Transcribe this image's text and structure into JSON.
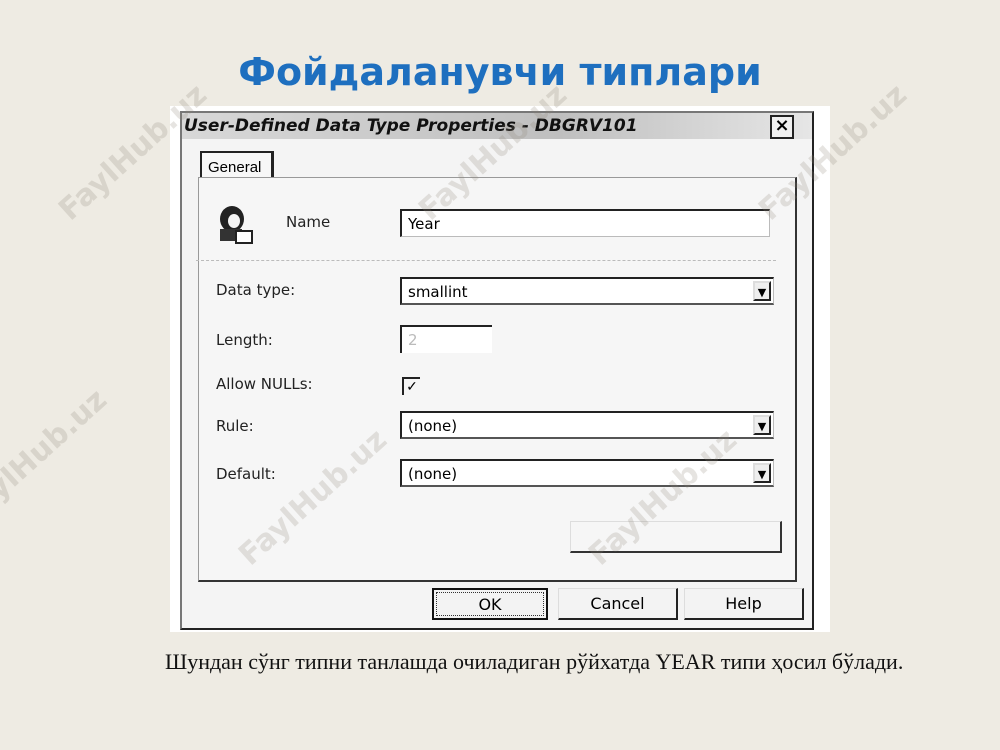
{
  "slide": {
    "title": "Фойдаланувчи типлари",
    "caption": "Шундан сўнг типни танлашда очиладиган рўйхатда YEAR типи ҳосил бўлади."
  },
  "dialog": {
    "title": "User-Defined Data Type Properties - DBGRV101",
    "close_label": "×",
    "tab_general": "General",
    "fields": {
      "name_label": "Name",
      "name_value": "Year",
      "data_type_label": "Data type:",
      "data_type_value": "smallint",
      "length_label": "Length:",
      "length_value": "2",
      "allow_nulls_label": "Allow NULLs:",
      "allow_nulls_checked": "✓",
      "rule_label": "Rule:",
      "rule_value": "(none)",
      "default_label": "Default:",
      "default_value": "(none)"
    },
    "buttons": {
      "ok": "OK",
      "cancel": "Cancel",
      "help": "Help"
    },
    "icons": {
      "user_type_icon": "user-type-icon",
      "dropdown_icon": "chevron-down-icon"
    }
  },
  "watermark": "FaylHub.uz",
  "colors": {
    "title": "#1e6fbf",
    "background": "#eeebe3"
  }
}
